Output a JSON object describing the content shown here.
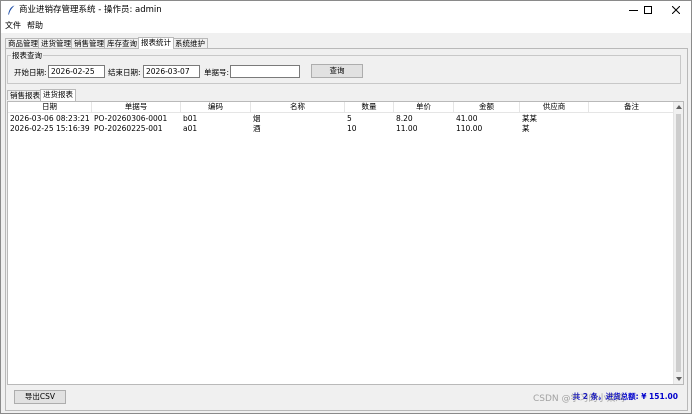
{
  "window": {
    "title": "商业进销存管理系统 - 操作员: admin",
    "icon": "feather-icon"
  },
  "menu": [
    "文件",
    "帮助"
  ],
  "tabs": [
    "商品管理",
    "进货管理",
    "销售管理",
    "库存查询",
    "报表统计",
    "系统维护"
  ],
  "active_tab": "报表统计",
  "query": {
    "group_title": "报表查询",
    "start_label": "开始日期:",
    "start_value": "2026-02-25",
    "end_label": "结束日期:",
    "end_value": "2026-03-07",
    "doc_label": "单据号:",
    "doc_value": "",
    "query_button": "查询"
  },
  "subtabs": [
    "销售报表",
    "进货报表"
  ],
  "active_subtab": "进货报表",
  "table": {
    "columns": [
      "日期",
      "单据号",
      "编码",
      "名称",
      "数量",
      "单价",
      "金额",
      "供应商",
      "备注"
    ],
    "rows": [
      [
        "2026-03-06 08:23:21",
        "PO-20260306-0001",
        "b01",
        "烟",
        "5",
        "8.20",
        "41.00",
        "某某",
        ""
      ],
      [
        "2026-02-25 15:16:39",
        "PO-20260225-001",
        "a01",
        "酒",
        "10",
        "11.00",
        "110.00",
        "某",
        ""
      ]
    ]
  },
  "footer": {
    "export_button": "导出CSV",
    "summary": "共 2 条，进货总额: ¥ 151.00",
    "watermark": "CSDN @学习的小菜鸡"
  },
  "colors": {
    "summary_text": "#0000cc"
  }
}
